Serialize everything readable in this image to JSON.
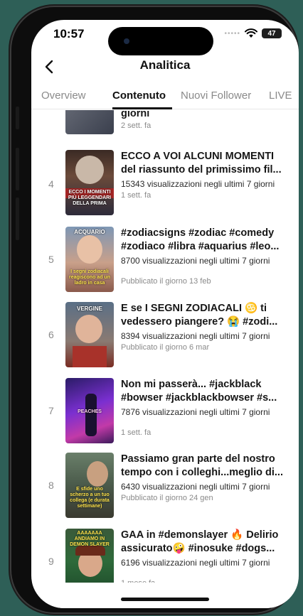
{
  "status": {
    "time": "10:57",
    "battery": "47"
  },
  "nav": {
    "title": "Analitica",
    "back_icon": "chevron-left-icon"
  },
  "tabs": [
    {
      "label": "Overview",
      "active": false
    },
    {
      "label": "Contenuto",
      "active": true
    },
    {
      "label": "Nuovi Follower",
      "active": false
    },
    {
      "label": "LIVE",
      "active": false
    }
  ],
  "partial": {
    "title": "giorni",
    "date": "2 sett. fa"
  },
  "items": [
    {
      "rank": "4",
      "title_line1": "ECCO A VOI ALCUNI MOMENTI",
      "title_line2": "del riassunto del primissimo fil...",
      "views": "15343 visualizzazioni negli ultimi 7 giorni",
      "date": "1 sett. fa",
      "thumb_text": "ECCO I MOMENTI PIÙ LEGGENDARI DELLA PRIMA"
    },
    {
      "rank": "5",
      "title_line1": "#zodiacsigns #zodiac #comedy",
      "title_line2": "#zodiaco #libra #aquarius #leo...",
      "views": "8700 visualizzazioni negli ultimi 7 giorni",
      "date": "Pubblicato il giorno 13 feb",
      "thumb_text": "ACQUARIO",
      "thumb_text2": "I segni zodiacali reagiscono ad un ladro in casa"
    },
    {
      "rank": "6",
      "title_line1": "E se I SEGNI ZODIACALI ♋ ti",
      "title_line2": "vedessero piangere? 😭  #zodi...",
      "views": "8394 visualizzazioni negli ultimi 7 giorni",
      "date": "Pubblicato il giorno 6 mar",
      "thumb_text": "VERGINE"
    },
    {
      "rank": "7",
      "title_line1": "Non mi passerà... #jackblack",
      "title_line2": "#bowser #jackblackbowser #s...",
      "views": "7876 visualizzazioni negli ultimi 7 giorni",
      "date": "1 sett. fa",
      "thumb_text": "PEACHES"
    },
    {
      "rank": "8",
      "title_line1": "Passiamo gran parte del nostro",
      "title_line2": "tempo con i colleghi...meglio di...",
      "views": "6430 visualizzazioni negli ultimi 7 giorni",
      "date": "Pubblicato il giorno 24 gen",
      "thumb_text": "E sfide uno scherzo a un tuo collega (e durata settimane)"
    },
    {
      "rank": "9",
      "title_line1": "GAA in #demonslayer 🔥 Delirio",
      "title_line2": "assicurato🤪 #inosuke #dogs...",
      "views": "6196 visualizzazioni negli ultimi 7 giorni",
      "date": "1 mese fa",
      "thumb_text": "AAAAAAA ANDIAMO IN DEMON SLAYER"
    }
  ]
}
